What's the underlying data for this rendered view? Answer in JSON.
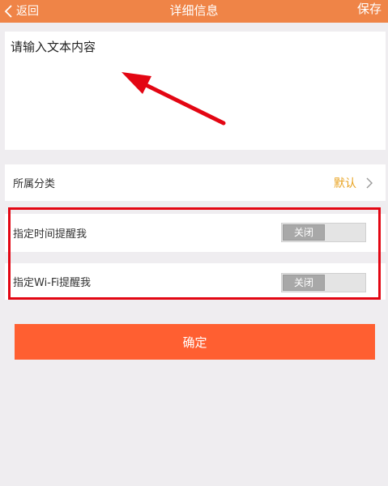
{
  "header": {
    "back_label": "返回",
    "title": "详细信息",
    "save_label": "保存",
    "background_color": "#ef8447"
  },
  "note": {
    "placeholder": "请输入文本内容",
    "value": ""
  },
  "category": {
    "label": "所属分类",
    "value": "默认"
  },
  "reminders": {
    "time": {
      "label": "指定时间提醒我",
      "toggle_label": "关闭",
      "enabled": false
    },
    "wifi": {
      "label": "指定Wi-Fi提醒我",
      "toggle_label": "关闭",
      "enabled": false
    }
  },
  "confirm": {
    "label": "确定",
    "color": "#ff5f31"
  },
  "annotation": {
    "color": "#e30613"
  },
  "icons": {
    "back": "chevron-left-icon",
    "category_chevron": "chevron-right-icon"
  }
}
